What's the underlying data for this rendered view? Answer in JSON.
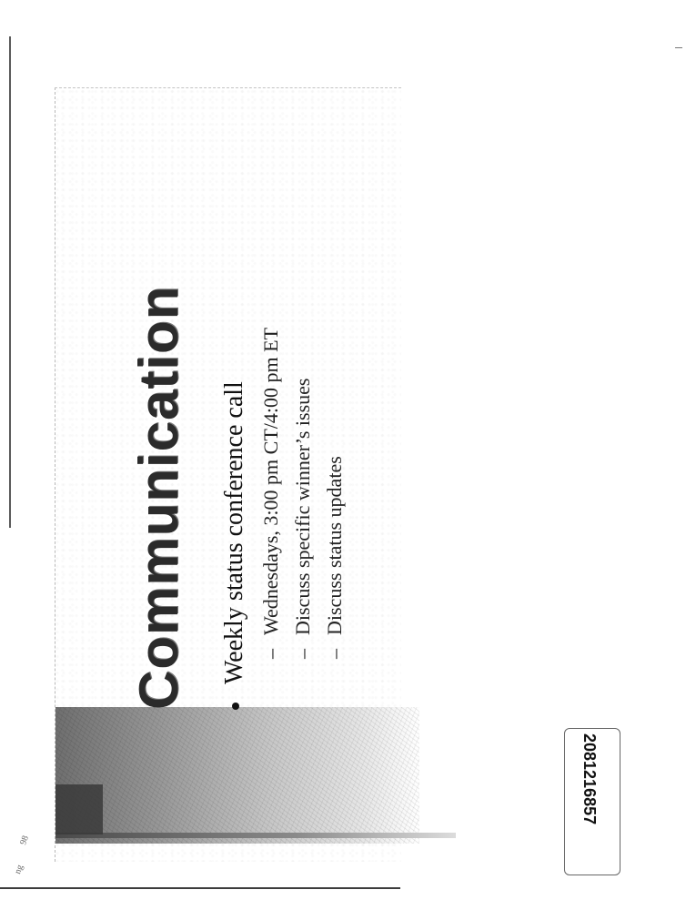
{
  "slide": {
    "title": "Communication",
    "bullets": [
      {
        "text": "Weekly status conference call",
        "subitems": [
          "Wednesdays, 3:00 pm CT/4:00 pm ET",
          "Discuss specific winner’s issues",
          "Discuss status updates"
        ]
      }
    ],
    "dash_glyph": "–"
  },
  "document_number": "2081216857",
  "margin_marks": [
    "98",
    "ng"
  ]
}
